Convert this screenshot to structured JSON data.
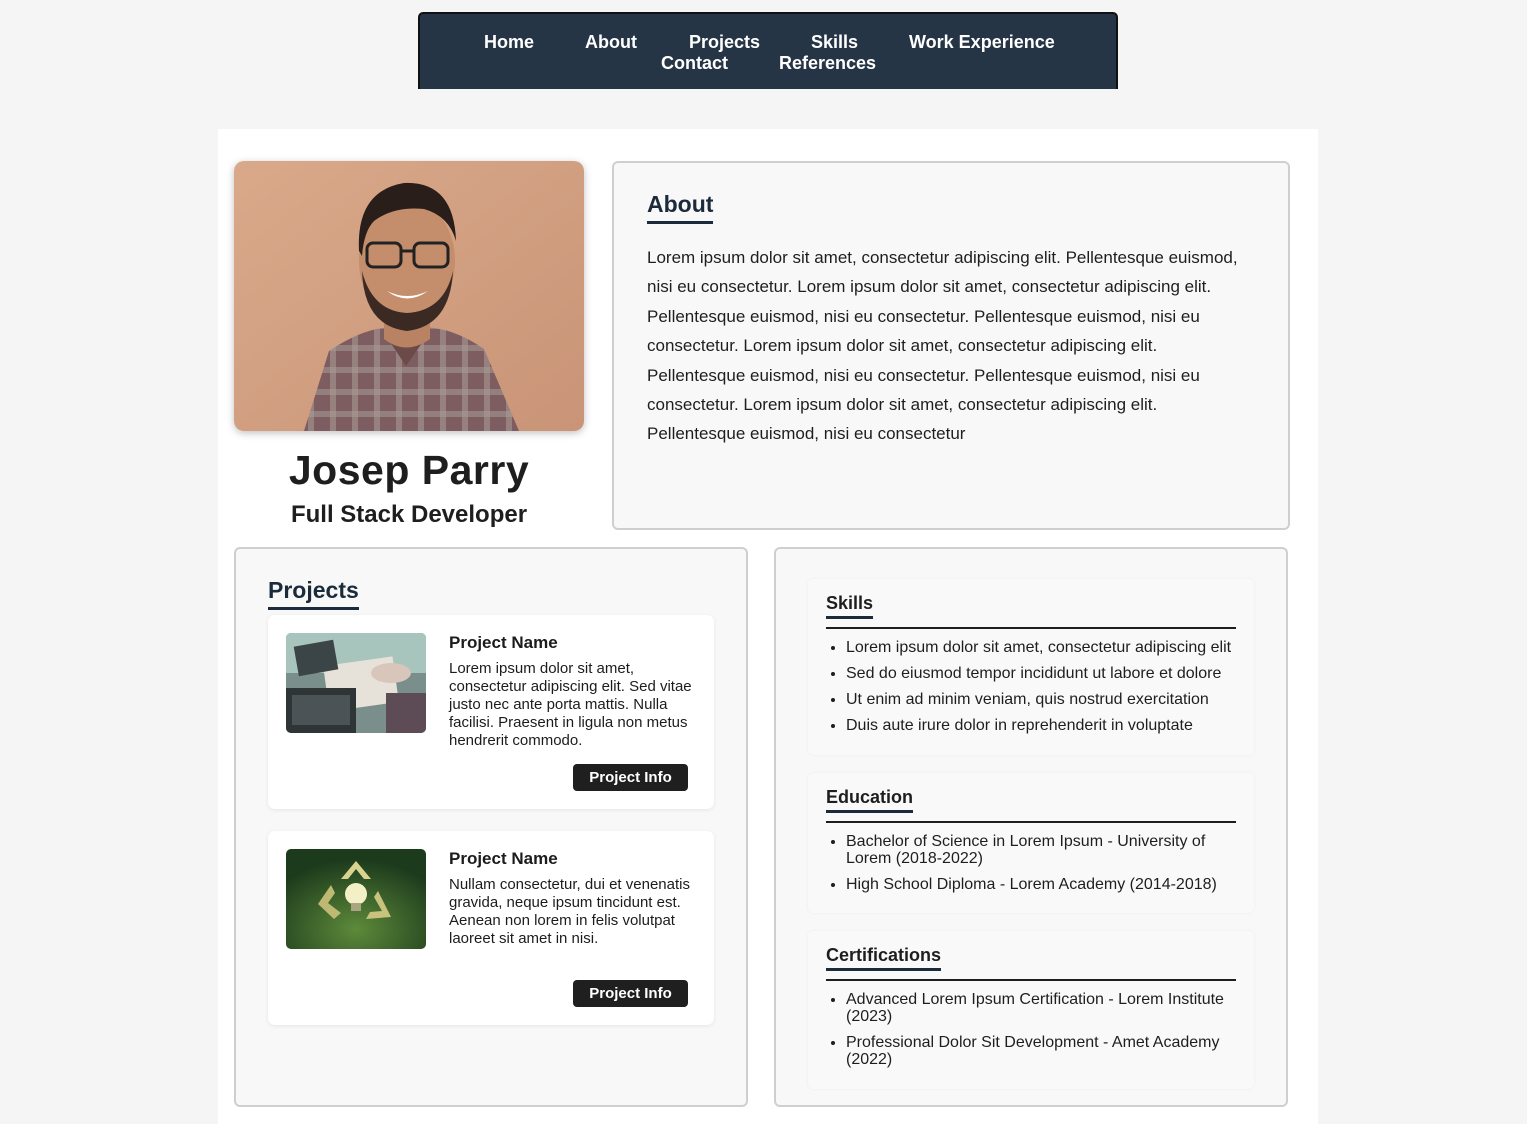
{
  "nav": {
    "items": [
      "Home",
      "About",
      "Projects",
      "Skills",
      "Work Experience",
      "Contact",
      "References"
    ]
  },
  "profile": {
    "name": "Josep Parry",
    "role": "Full Stack Developer"
  },
  "about": {
    "title": "About",
    "text": "Lorem ipsum dolor sit amet, consectetur adipiscing elit. Pellentesque euismod, nisi eu consectetur. Lorem ipsum dolor sit amet, consectetur adipiscing elit. Pellentesque euismod, nisi eu consectetur. Pellentesque euismod, nisi eu consectetur. Lorem ipsum dolor sit amet, consectetur adipiscing elit. Pellentesque euismod, nisi eu consectetur. Pellentesque euismod, nisi eu consectetur. Lorem ipsum dolor sit amet, consectetur adipiscing elit. Pellentesque euismod, nisi eu consectetur"
  },
  "projects": {
    "title": "Projects",
    "items": [
      {
        "name": "Project Name",
        "desc": "Lorem ipsum dolor sit amet, consectetur adipiscing elit. Sed vitae justo nec ante porta mattis. Nulla facilisi. Praesent in ligula non metus hendrerit commodo.",
        "button": "Project Info"
      },
      {
        "name": "Project Name",
        "desc": "Nullam consectetur, dui et venenatis gravida, neque ipsum tincidunt est. Aenean non lorem in felis volutpat laoreet sit amet in nisi.",
        "button": "Project Info"
      }
    ]
  },
  "skills": {
    "title": "Skills",
    "items": [
      "Lorem ipsum dolor sit amet, consectetur adipiscing elit",
      "Sed do eiusmod tempor incididunt ut labore et dolore",
      "Ut enim ad minim veniam, quis nostrud exercitation",
      "Duis aute irure dolor in reprehenderit in voluptate"
    ]
  },
  "education": {
    "title": "Education",
    "items": [
      "Bachelor of Science in Lorem Ipsum - University of Lorem (2018-2022)",
      "High School Diploma - Lorem Academy (2014-2018)"
    ]
  },
  "certifications": {
    "title": "Certifications",
    "items": [
      "Advanced Lorem Ipsum Certification - Lorem Institute (2023)",
      "Professional Dolor Sit Development - Amet Academy (2022)"
    ]
  },
  "colors": {
    "nav_bg": "#263545",
    "accent": "#1c2b3c",
    "button_bg": "#1f1f1f"
  }
}
